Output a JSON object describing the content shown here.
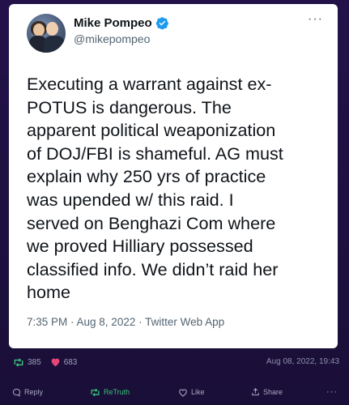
{
  "tweet": {
    "display_name": "Mike Pompeo",
    "handle": "@mikepompeo",
    "text": "Executing a warrant against ex-\nPOTUS is dangerous. The\napparent political weaponization\nof DOJ/FBI is shameful. AG must\nexplain why 250 yrs of practice\nwas upended w/ this raid. I\nserved on Benghazi Com where\nwe proved Hilliary possessed\nclassified info. We didn’t raid her\nhome",
    "meta": "7:35 PM · Aug 8, 2022 · Twitter Web App",
    "more_glyph": "···"
  },
  "post": {
    "retruth_count": "385",
    "like_count": "683",
    "timestamp": "Aug 08, 2022, 19:43"
  },
  "actions": {
    "reply_label": "Reply",
    "retruth_label": "ReTruth",
    "like_label": "Like",
    "share_label": "Share",
    "more_glyph": "···"
  },
  "colors": {
    "background": "#1b0f3a",
    "verified": "#1d9bf0",
    "retruth": "#37c178",
    "like": "#e8457a"
  },
  "icons": [
    "verified-badge-icon",
    "more-icon",
    "retruth-icon",
    "heart-icon",
    "reply-icon",
    "like-icon",
    "share-icon"
  ]
}
